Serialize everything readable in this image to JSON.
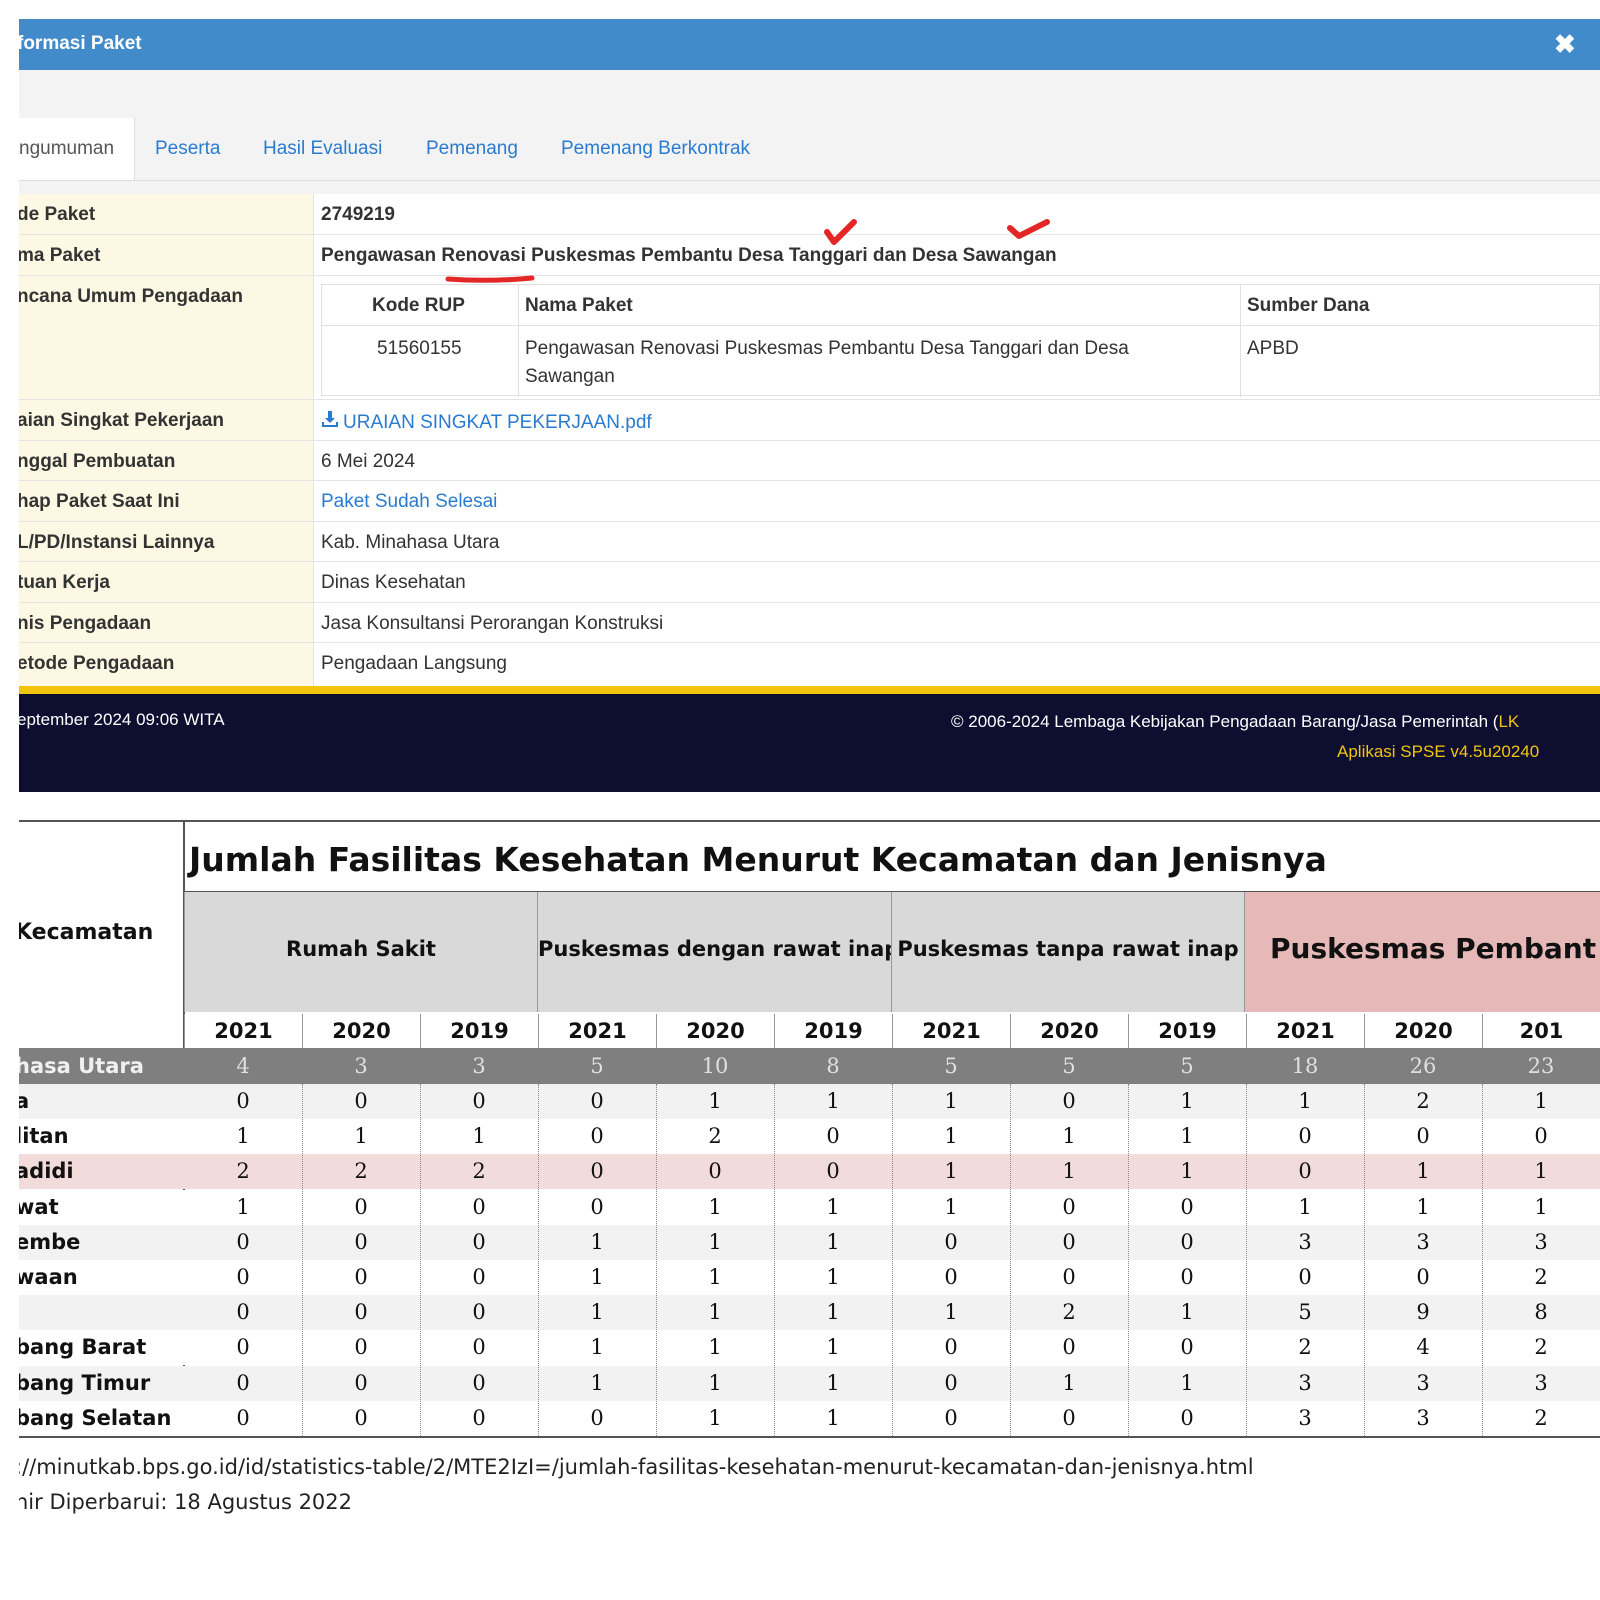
{
  "modal": {
    "title": "formasi Paket",
    "close_icon": "close-icon"
  },
  "tabs": [
    "ngumuman",
    "Peserta",
    "Hasil Evaluasi",
    "Pemenang",
    "Pemenang Berkontrak"
  ],
  "info": {
    "kode_paket": {
      "label": "de Paket",
      "value": "2749219"
    },
    "nama_paket": {
      "label": "ma Paket",
      "value": "Pengawasan Renovasi Puskesmas Pembantu Desa Tanggari dan Desa Sawangan"
    },
    "rup": {
      "label": "ncana Umum Pengadaan",
      "headers": [
        "Kode RUP",
        "Nama Paket",
        "Sumber Dana"
      ],
      "kode": "51560155",
      "nama_line1": "Pengawasan Renovasi Puskesmas Pembantu Desa Tanggari dan Desa",
      "nama_line2": "Sawangan",
      "sumber": "APBD"
    },
    "uraian": {
      "label": "aian Singkat Pekerjaan",
      "value": "URAIAN SINGKAT PEKERJAAN.pdf",
      "icon": "download-icon"
    },
    "tanggal": {
      "label": "nggal Pembuatan",
      "value": "6 Mei 2024"
    },
    "tahap": {
      "label": "hap Paket Saat Ini",
      "value": "Paket Sudah Selesai"
    },
    "instansi": {
      "label": "L/PD/Instansi Lainnya",
      "value": "Kab. Minahasa Utara"
    },
    "satuan": {
      "label": "tuan Kerja",
      "value": "Dinas Kesehatan"
    },
    "jenis": {
      "label": "nis Pengadaan",
      "value": "Jasa Konsultansi Perorangan Konstruksi"
    },
    "metode": {
      "label": "etode Pengadaan",
      "value": "Pengadaan Langsung"
    }
  },
  "footer": {
    "timestamp": "eptember 2024 09:06 WITA",
    "copyright": "© 2006-2024 Lembaga Kebijakan Pengadaan Barang/Jasa Pemerintah (",
    "copyright_tail": "LK",
    "app": "Aplikasi SPSE v4.5u20240"
  },
  "colors": {
    "header_blue": "#428bca",
    "link_blue": "#2a7bd0",
    "label_bg": "#fcf8e3",
    "footer_yellow": "#f1c40f",
    "footer_dark": "#0e0e30",
    "annotation_red": "#e32626",
    "highlight_row": "#f2dcdb",
    "pink_header": "#e6b8b7"
  },
  "stats": {
    "title": "Jumlah Fasilitas Kesehatan Menurut Kecamatan dan Jenisnya",
    "kecamatan_header": "Kecamatan",
    "groups": [
      "Rumah Sakit",
      "Puskesmas dengan rawat inap",
      "Puskesmas tanpa rawat inap",
      "Puskesmas Pembant"
    ],
    "years": [
      "2021",
      "2020",
      "2019",
      "2021",
      "2020",
      "2019",
      "2021",
      "2020",
      "2019",
      "2021",
      "2020",
      "201"
    ],
    "total_name": "hasa Utara",
    "total": [
      "4",
      "3",
      "3",
      "5",
      "10",
      "8",
      "5",
      "5",
      "5",
      "18",
      "26",
      "23"
    ],
    "rows": [
      {
        "name": "a",
        "v": [
          "0",
          "0",
          "0",
          "0",
          "1",
          "1",
          "1",
          "0",
          "1",
          "1",
          "2",
          "1"
        ]
      },
      {
        "name": "litan",
        "v": [
          "1",
          "1",
          "1",
          "0",
          "2",
          "0",
          "1",
          "1",
          "1",
          "0",
          "0",
          "0"
        ]
      },
      {
        "name": "adidi",
        "v": [
          "2",
          "2",
          "2",
          "0",
          "0",
          "0",
          "1",
          "1",
          "1",
          "0",
          "1",
          "1"
        ]
      },
      {
        "name": "wat",
        "v": [
          "1",
          "0",
          "0",
          "0",
          "1",
          "1",
          "1",
          "0",
          "0",
          "1",
          "1",
          "1"
        ]
      },
      {
        "name": "embe",
        "v": [
          "0",
          "0",
          "0",
          "1",
          "1",
          "1",
          "0",
          "0",
          "0",
          "3",
          "3",
          "3"
        ]
      },
      {
        "name": "waan",
        "v": [
          "0",
          "0",
          "0",
          "1",
          "1",
          "1",
          "0",
          "0",
          "0",
          "0",
          "0",
          "2"
        ]
      },
      {
        "name": "",
        "v": [
          "0",
          "0",
          "0",
          "1",
          "1",
          "1",
          "1",
          "2",
          "1",
          "5",
          "9",
          "8"
        ]
      },
      {
        "name": "bang Barat",
        "v": [
          "0",
          "0",
          "0",
          "1",
          "1",
          "1",
          "0",
          "0",
          "0",
          "2",
          "4",
          "2"
        ]
      },
      {
        "name": "bang Timur",
        "v": [
          "0",
          "0",
          "0",
          "1",
          "1",
          "1",
          "0",
          "1",
          "1",
          "3",
          "3",
          "3"
        ]
      },
      {
        "name": "bang Selatan",
        "v": [
          "0",
          "0",
          "0",
          "0",
          "1",
          "1",
          "0",
          "0",
          "0",
          "3",
          "3",
          "2"
        ]
      }
    ],
    "source_url": "://minutkab.bps.go.id/id/statistics-table/2/MTE2IzI=/jumlah-fasilitas-kesehatan-menurut-kecamatan-dan-jenisnya.html",
    "updated": "hir Diperbarui: 18 Agustus 2022"
  }
}
